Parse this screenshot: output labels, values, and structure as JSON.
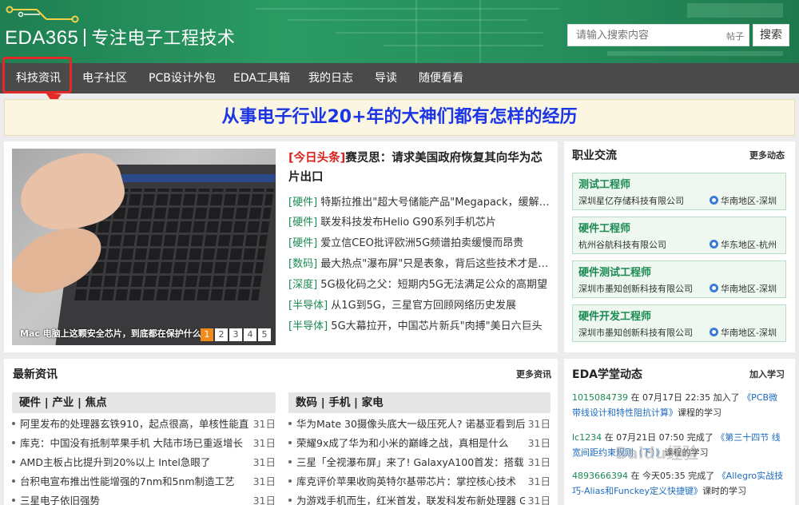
{
  "header": {
    "logo": "EDA365",
    "slogan": "专注电子工程技术",
    "search_placeholder": "请输入搜索内容",
    "search_scope": "帖子",
    "search_button": "搜索"
  },
  "nav": {
    "items": [
      "科技资讯",
      "电子社区",
      "PCB设计外包",
      "EDA工具箱",
      "我的日志",
      "导读",
      "随便看看"
    ]
  },
  "banner": {
    "text": "从事电子行业20+年的大神们都有怎样的经历"
  },
  "featured": {
    "image_caption": "Mac 电脑上这颗安全芯片，到底都在保护什么",
    "pages": [
      "1",
      "2",
      "3",
      "4",
      "5"
    ],
    "headline_tag": "[今日头条]",
    "headline_text": "赛灵思：请求美国政府恢复其向华为芯片出口",
    "news": [
      {
        "cat": "[硬件]",
        "title": "特斯拉推出\"超大号储能产品\"Megapack，缓解电厂..."
      },
      {
        "cat": "[硬件]",
        "title": "联发科技发布Helio G90系列手机芯片"
      },
      {
        "cat": "[硬件]",
        "title": "爱立信CEO批评欧洲5G频谱拍卖缓慢而昂贵"
      },
      {
        "cat": "[数码]",
        "title": "最大热点\"瀑布屏\"只是表象，背后这些技术才是真..."
      },
      {
        "cat": "[深度]",
        "title": "5G极化码之父：短期内5G无法满足公众的高期望"
      },
      {
        "cat": "[半导体]",
        "title": "从1G到5G，三星官方回顾网络历史发展"
      },
      {
        "cat": "[半导体]",
        "title": "5G大幕拉开，中国芯片新兵\"肉搏\"美日六巨头"
      }
    ]
  },
  "jobs": {
    "title": "职业交流",
    "more": "更多动态",
    "items": [
      {
        "title": "测试工程师",
        "company": "深圳星亿存储科技有限公司",
        "location": "华南地区-深圳"
      },
      {
        "title": "硬件工程师",
        "company": "杭州谷航科技有限公司",
        "location": "华东地区-杭州"
      },
      {
        "title": "硬件测试工程师",
        "company": "深圳市墨知创新科技有限公司",
        "location": "华南地区-深圳"
      },
      {
        "title": "硬件开发工程师",
        "company": "深圳市墨知创新科技有限公司",
        "location": "华南地区-深圳"
      }
    ]
  },
  "latest": {
    "title": "最新资讯",
    "more": "更多资讯",
    "left_header": "硬件 | 产业 | 焦点",
    "right_header": "数码 | 手机 | 家电",
    "left": [
      {
        "title": "阿里发布的处理器玄铁910，起点很高，单核性能直",
        "date": "31日"
      },
      {
        "title": "库克：中国没有抵制苹果手机 大陆市场已重返增长",
        "date": "31日"
      },
      {
        "title": "AMD主板占比提升到20%以上 Intel急眼了",
        "date": "31日"
      },
      {
        "title": "台积电宣布推出性能增强的7nm和5nm制造工艺",
        "date": "31日"
      },
      {
        "title": "三星电子依旧强势",
        "date": "31日"
      }
    ],
    "right": [
      {
        "title": "华为Mate 30摄像头底大一级压死人? 诺基亚看到后",
        "date": "31日"
      },
      {
        "title": "荣耀9x成了华为和小米的巅峰之战，真相是什么",
        "date": "31日"
      },
      {
        "title": "三星「全视瀑布屏」来了! GalaxyA100首发：搭载",
        "date": "31日"
      },
      {
        "title": "库克评价苹果收购英特尔基带芯片：掌控核心技术",
        "date": "31日"
      },
      {
        "title": "为游戏手机而生，红米首发，联发科发布新处理器 G",
        "date": "31日"
      }
    ]
  },
  "eda": {
    "title": "EDA学堂动态",
    "more": "加入学习",
    "items": [
      {
        "user": "1015084739",
        "text": " 在 07月17日 22:35 加入了 ",
        "course": "《PCB微带线设计和特性阻抗计算》",
        "tail": "课程的学习"
      },
      {
        "user": "lc1234",
        "text": " 在 07月21日 07:50 完成了 ",
        "course": "《第三十四节 线宽间距约束规则（下）》",
        "tail": "课程的学习"
      },
      {
        "user": "4893666394",
        "text": " 在 今天05:35 完成了 ",
        "course": "《Allegro实战技巧-Alias和Funckey定义快捷键》",
        "tail": "课时的学习"
      }
    ]
  },
  "watermark": "Baidu经验",
  "colors": {
    "header_green": "#27905e",
    "nav_bg": "#4a4a4a",
    "banner_text": "#1b35e6",
    "accent_green": "#1b8a52",
    "headline_red": "#d8201a",
    "pager_active": "#f08b1c",
    "highlight_red": "#e32929"
  }
}
